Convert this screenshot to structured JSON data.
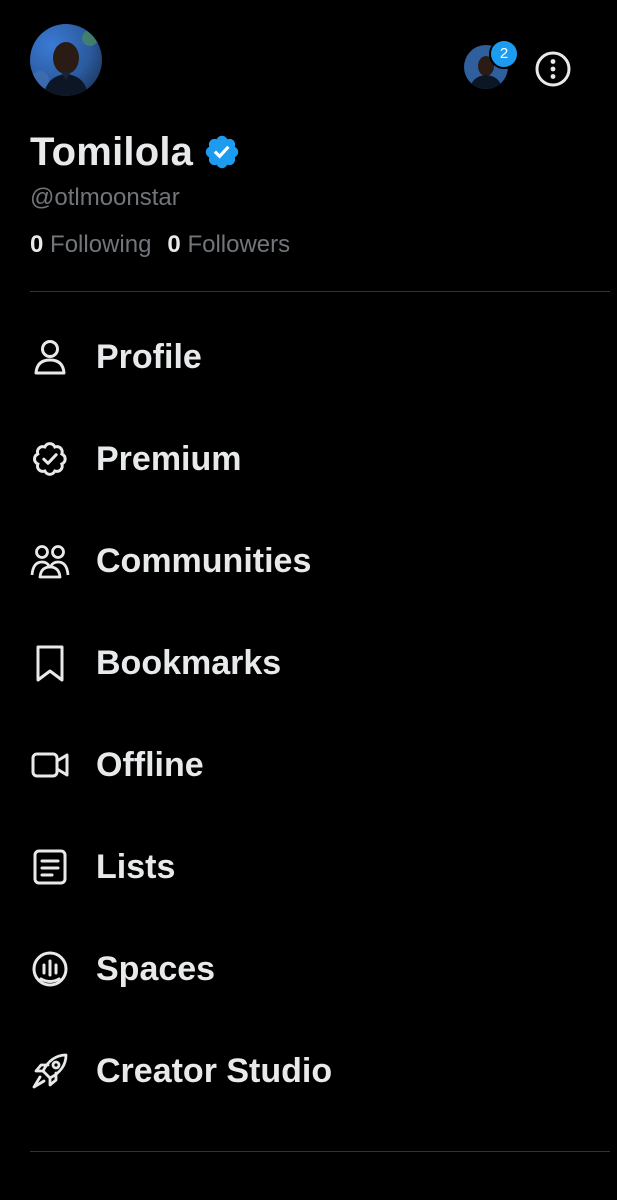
{
  "profile": {
    "display_name": "Tomilola",
    "handle": "@otlmoonstar",
    "following_count": "0",
    "following_label": "Following",
    "followers_count": "0",
    "followers_label": "Followers",
    "verified_icon": "verified-badge-icon"
  },
  "account_switcher": {
    "badge_count": "2"
  },
  "more_icon": "more-options-icon",
  "menu": {
    "items": [
      {
        "label": "Profile",
        "icon": "person-icon"
      },
      {
        "label": "Premium",
        "icon": "premium-badge-icon"
      },
      {
        "label": "Communities",
        "icon": "communities-icon"
      },
      {
        "label": "Bookmarks",
        "icon": "bookmark-icon"
      },
      {
        "label": "Offline",
        "icon": "video-camera-icon"
      },
      {
        "label": "Lists",
        "icon": "list-icon"
      },
      {
        "label": "Spaces",
        "icon": "spaces-icon"
      },
      {
        "label": "Creator Studio",
        "icon": "rocket-icon"
      }
    ]
  },
  "colors": {
    "background": "#000000",
    "primary_text": "#e7e9ea",
    "secondary_text": "#71767b",
    "accent": "#1d9bf0",
    "divider": "#2f3336"
  }
}
